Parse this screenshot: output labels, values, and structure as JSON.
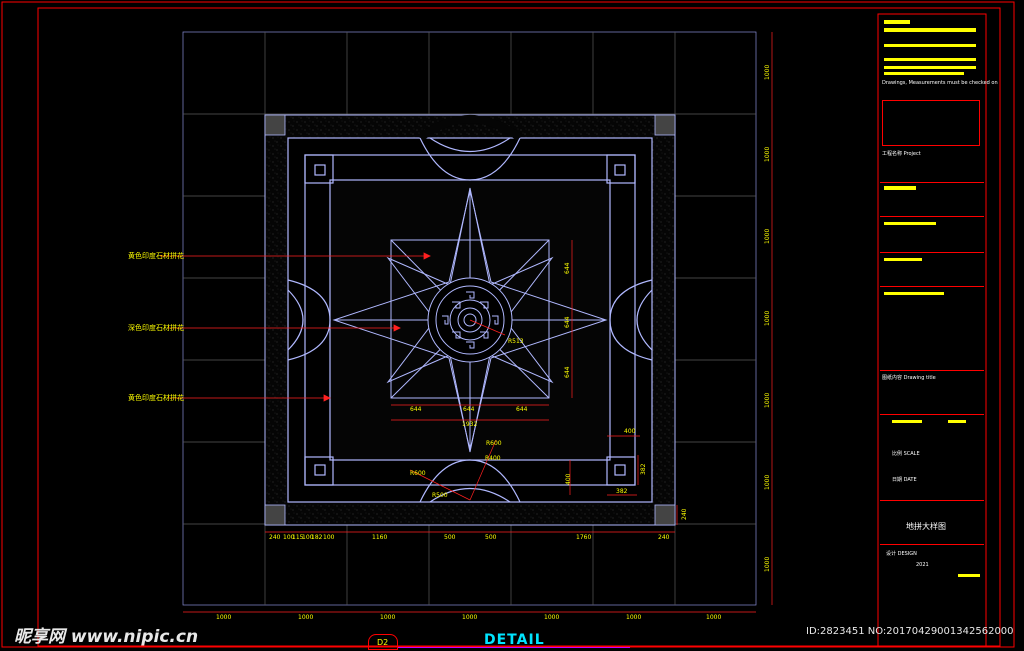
{
  "drawing": {
    "detail_label": "DETAIL",
    "detail_tag": "D2",
    "drawing_name": "地拼大样图",
    "year": "2021",
    "notes_line": "Drawings, Measurements must be checked on"
  },
  "callouts": [
    {
      "label": "黄色印度石材拼花"
    },
    {
      "label": "深色印度石材拼花"
    },
    {
      "label": "黄色印度石材拼花"
    }
  ],
  "dims": {
    "right_column": [
      "1000",
      "1000",
      "1000",
      "1000",
      "1000",
      "1000",
      "1000"
    ],
    "bottom_row": [
      "1000",
      "1000",
      "1000",
      "1000",
      "1000",
      "1000",
      "1000"
    ],
    "inner_bottom": [
      "240",
      "100",
      "115",
      "100",
      "182",
      "100",
      "1160",
      "500",
      "500",
      "1760",
      "240"
    ],
    "star_v": [
      "644",
      "644",
      "644"
    ],
    "star_h": [
      "644",
      "644",
      "644"
    ],
    "star_total": "1932",
    "small_a": "400",
    "small_b": "382",
    "small_c": "400",
    "small_d": "382",
    "corner": "240",
    "r_label": "R513",
    "arc_r1": "R500",
    "arc_r2": "R600",
    "arc_r3": "R400",
    "arc_r4": "R600"
  },
  "titleblock": {
    "project_label": "工程名称 Project",
    "content_label": "图纸内容 Drawing title",
    "scale_label": "比例 SCALE",
    "date_label": "日期 DATE",
    "drawn_label": "设计 DESIGN"
  },
  "watermark": {
    "site": "昵享网 www.nipic.cn",
    "id_line": "ID:2823451 NO:20170429001342562000"
  },
  "colors": {
    "frame": "#ff0000",
    "grid": "#5a5a5a",
    "pattern": "#b0b8ff",
    "dimension": "#ff2020",
    "text": "#ffff00",
    "accent": "#00e5ff"
  }
}
